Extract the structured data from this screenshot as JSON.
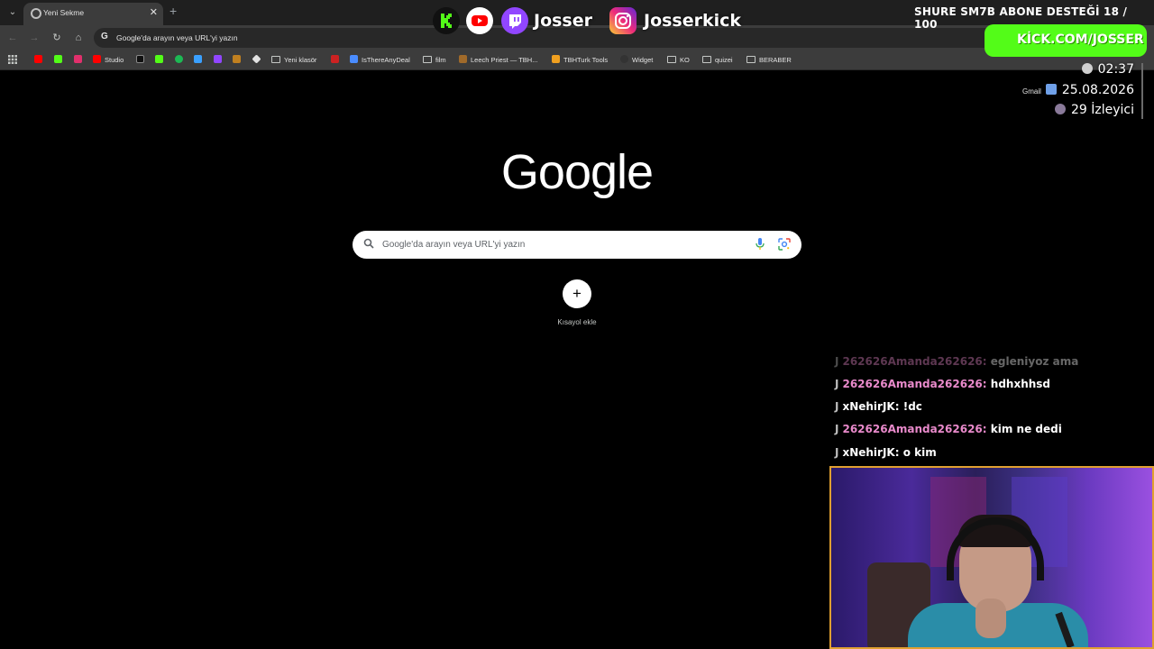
{
  "browser": {
    "tab": {
      "title": "Yeni Sekme"
    },
    "omnibox": {
      "text": "Google'da arayın veya URL'yi yazın"
    },
    "bookmarks": [
      {
        "label": "Studio",
        "icon": "youtube-studio-icon",
        "color": "#ff0000"
      },
      {
        "label": "Yeni klasör",
        "icon": "folder-icon"
      },
      {
        "label": "IsThereAnyDeal",
        "icon": "isthereanydeal-icon",
        "color": "#4a8cff"
      },
      {
        "label": "film",
        "icon": "folder-icon"
      },
      {
        "label": "Leech Priest — TBH...",
        "icon": "leech-icon",
        "color": "#a06a2a"
      },
      {
        "label": "TBHTurk Tools",
        "icon": "tbh-icon",
        "color": "#f0a020"
      },
      {
        "label": "Widget",
        "icon": "widget-icon",
        "color": "#333333"
      },
      {
        "label": "KO",
        "icon": "folder-icon"
      },
      {
        "label": "quizei",
        "icon": "folder-icon"
      },
      {
        "label": "BERABER",
        "icon": "folder-icon"
      }
    ],
    "gmail_link": "Gmail"
  },
  "ntp": {
    "logo": "Google",
    "search_placeholder": "Google'da arayın veya URL'yi yazın",
    "shortcut_label": "Kısayol ekle"
  },
  "overlay": {
    "socials": [
      {
        "icon": "kick-icon",
        "color": "#53fc18"
      },
      {
        "icon": "youtube-icon",
        "color": "#ff0000"
      },
      {
        "icon": "twitch-icon",
        "color": "#9146ff",
        "label": "Josser"
      },
      {
        "icon": "instagram-icon",
        "color": "#e1306c",
        "label": "Josserkick"
      }
    ],
    "goal_text": "SHURE SM7B ABONE DESTEĞİ 18 / 100",
    "kick_banner": "KİCK.COM/JOSSER",
    "time": "02:37",
    "date": "25.08.2026",
    "viewers": "29 İzleyici",
    "chat": [
      {
        "user": "262626Amanda262626",
        "message": "egleniyoz ama",
        "user_color": "pink",
        "faded": true
      },
      {
        "user": "262626Amanda262626",
        "message": "hdhxhhsd",
        "user_color": "pink",
        "faded": false
      },
      {
        "user": "xNehirJK",
        "message": "!dc",
        "user_color": "white",
        "faded": false
      },
      {
        "user": "262626Amanda262626",
        "message": "kim ne dedi",
        "user_color": "pink",
        "faded": false
      },
      {
        "user": "xNehirJK",
        "message": "o kim",
        "user_color": "white",
        "faded": false
      }
    ]
  }
}
